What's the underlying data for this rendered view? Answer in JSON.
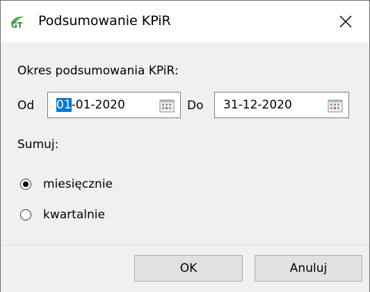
{
  "window": {
    "title": "Podsumowanie KPiR",
    "app_icon": "gt-logo-icon",
    "close_icon": "close-icon"
  },
  "period": {
    "label": "Okres podsumowania KPiR:",
    "from_label": "Od",
    "from_value_selected": "01",
    "from_value_rest": "-01-2020",
    "to_label": "Do",
    "to_value": "31-12-2020",
    "calendar_icon": "calendar-icon"
  },
  "sum": {
    "label": "Sumuj:",
    "options": [
      {
        "label": "miesięcznie",
        "selected": true
      },
      {
        "label": "kwartalnie",
        "selected": false
      }
    ]
  },
  "buttons": {
    "ok": "OK",
    "cancel": "Anuluj"
  },
  "colors": {
    "selection": "#0078d7",
    "dialog_bg": "#f0f0f0",
    "button_bg": "#e1e1e1"
  }
}
